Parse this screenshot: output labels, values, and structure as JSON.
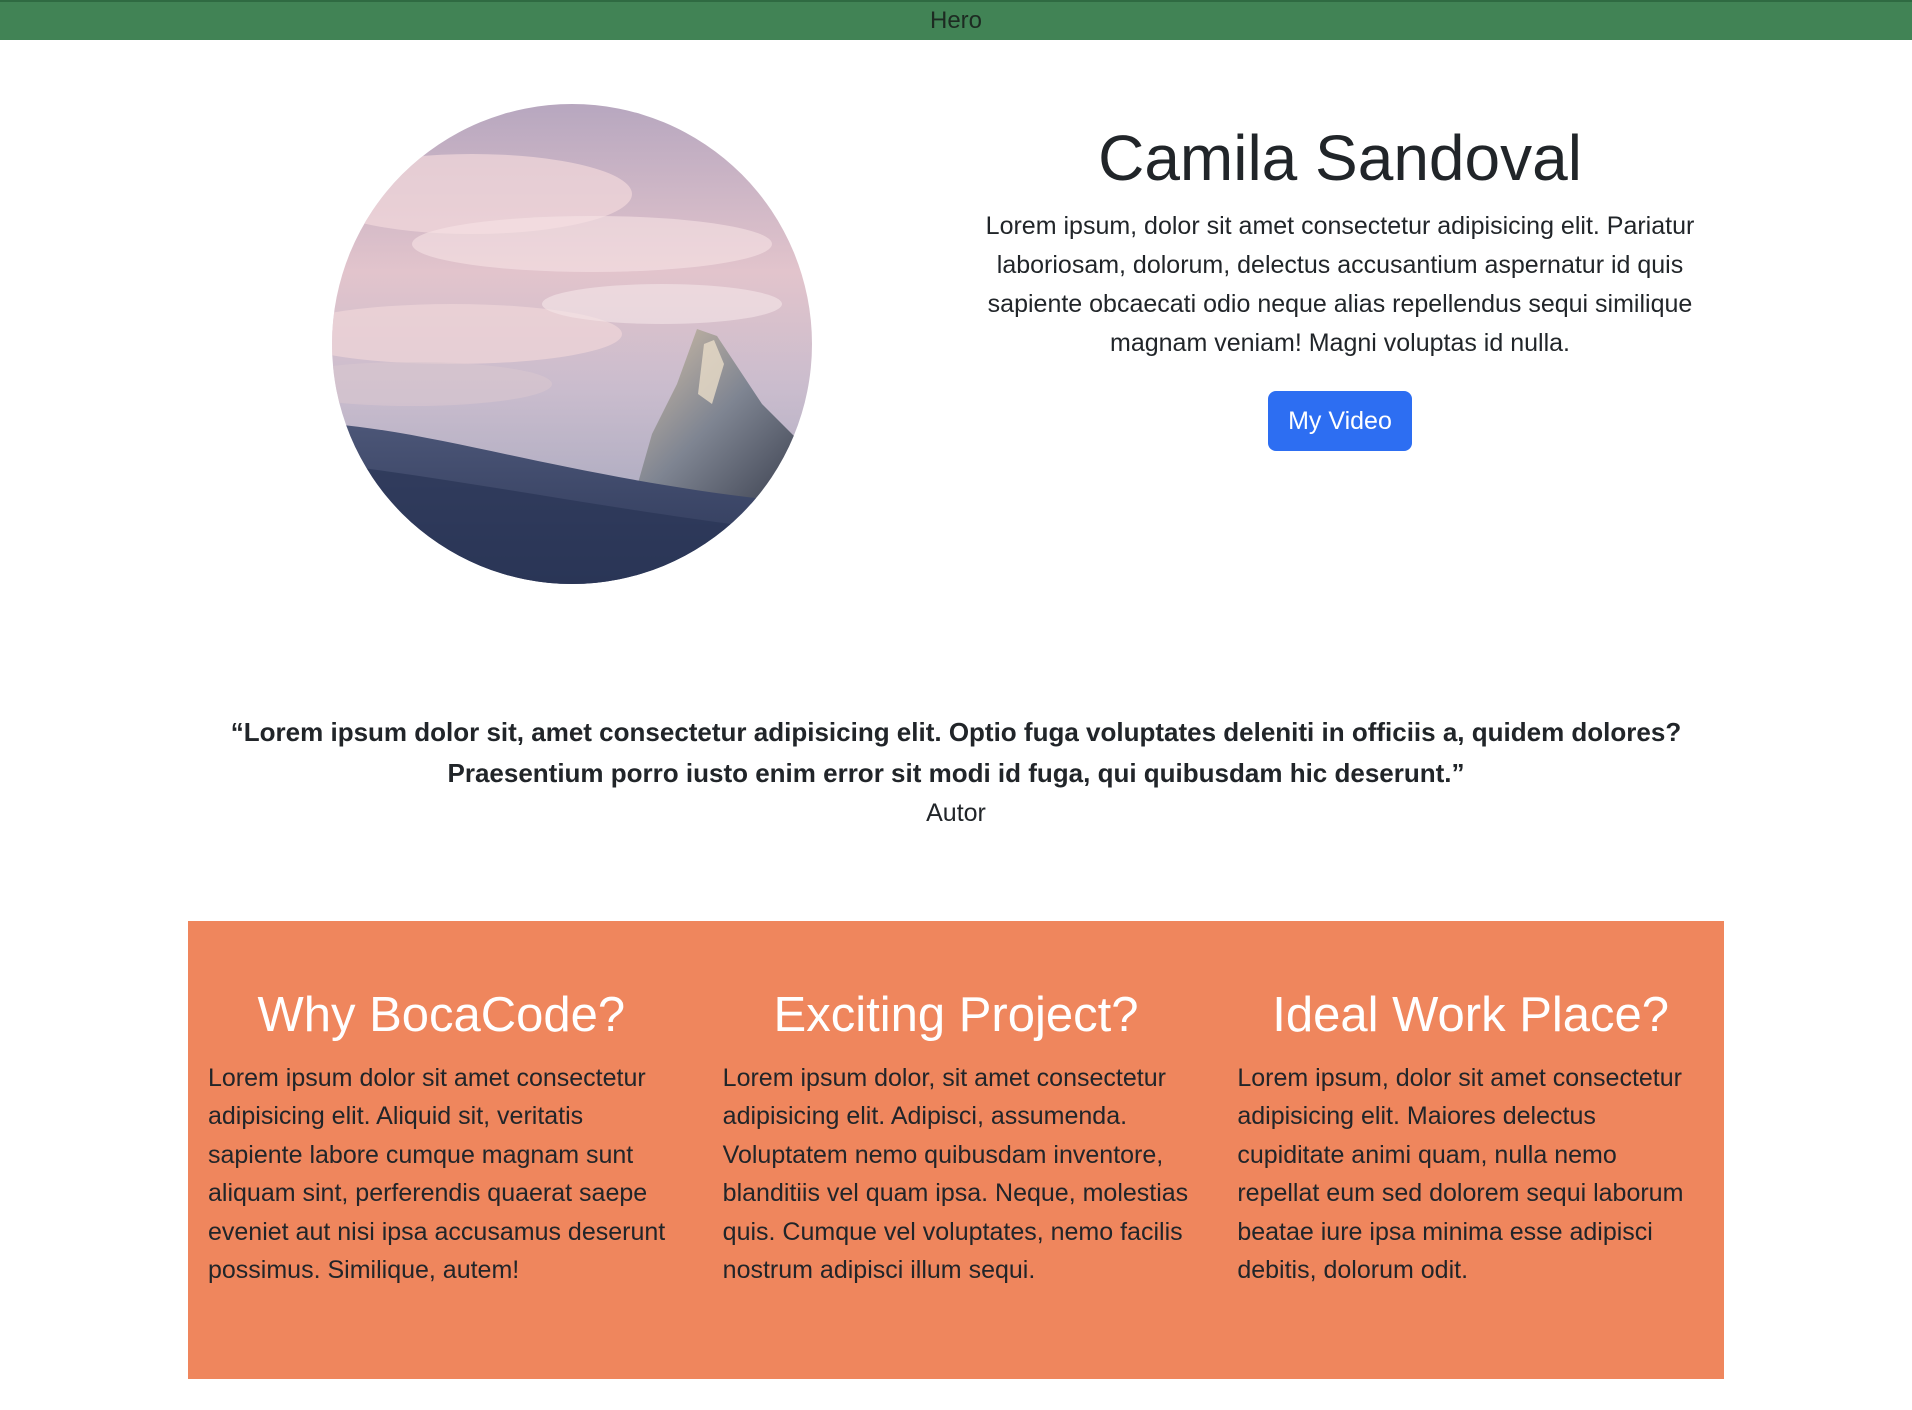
{
  "topbar": {
    "title": "Hero"
  },
  "hero": {
    "image_alt": "mountain-peak-photo",
    "name": "Camila Sandoval",
    "description": "Lorem ipsum, dolor sit amet consectetur adipisicing elit. Pariatur laboriosam, dolorum, delectus accusantium aspernatur id quis sapiente obcaecati odio neque alias repellendus sequi similique magnam veniam! Magni voluptas id nulla.",
    "button_label": "My Video"
  },
  "quote": {
    "text": "“Lorem ipsum dolor sit, amet consectetur adipisicing elit. Optio fuga voluptates deleniti in officiis a, quidem dolores? Praesentium porro iusto enim error sit modi id fuga, qui quibusdam hic deserunt.”",
    "author": "Autor"
  },
  "features": [
    {
      "title": "Why BocaCode?",
      "body": "Lorem ipsum dolor sit amet consectetur adipisicing elit. Aliquid sit, veritatis sapiente labore cumque magnam sunt aliquam sint, perferendis quaerat saepe eveniet aut nisi ipsa accusamus deserunt possimus. Similique, autem!"
    },
    {
      "title": "Exciting Project?",
      "body": "Lorem ipsum dolor, sit amet consectetur adipisicing elit. Adipisci, assumenda. Voluptatem nemo quibusdam inventore, blanditiis vel quam ipsa. Neque, molestias quis. Cumque vel voluptates, nemo facilis nostrum adipisci illum sequi."
    },
    {
      "title": "Ideal Work Place?",
      "body": "Lorem ipsum, dolor sit amet consectetur adipisicing elit. Maiores delectus cupiditate animi quam, nulla nemo repellat eum sed dolorem sequi laborum beatae iure ipsa minima esse adipisci debitis, dolorum odit."
    }
  ],
  "colors": {
    "topbar": "#418355",
    "button": "#2d6ef2",
    "features_background": "#ef865d",
    "feature_title": "#ffffff"
  }
}
